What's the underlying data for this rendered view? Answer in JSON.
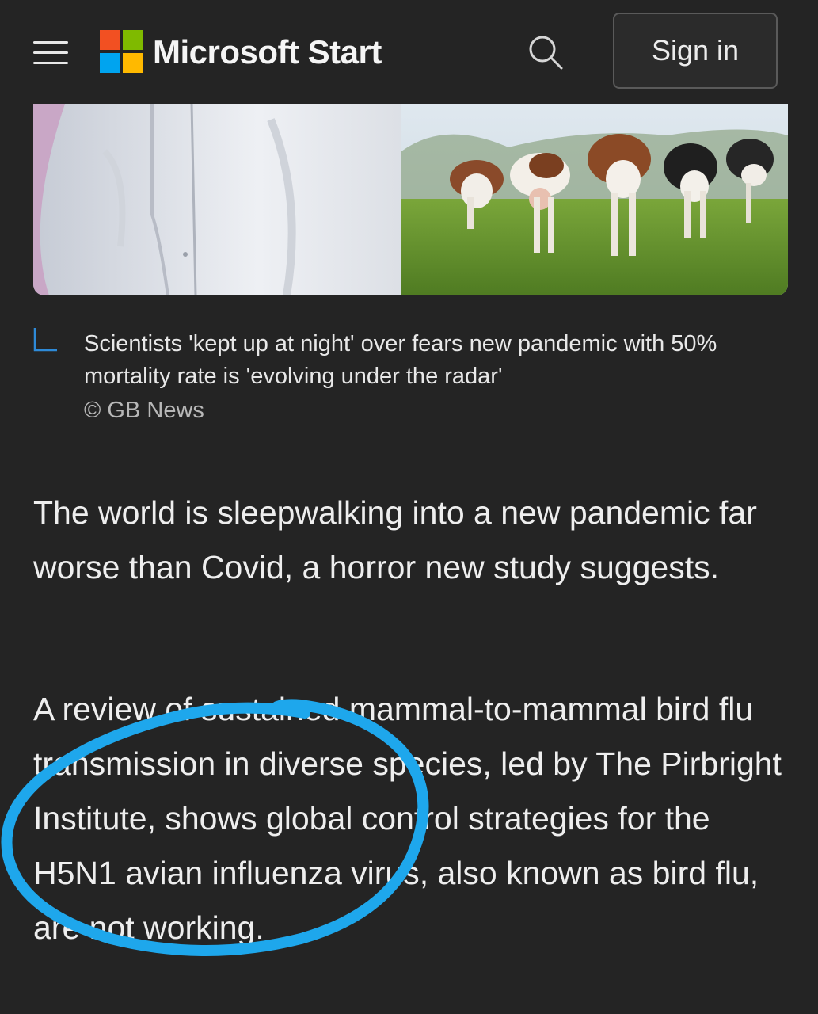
{
  "header": {
    "menu_icon": "hamburger-menu-icon",
    "logo_icon": "microsoft-logo-icon",
    "brand": "Microsoft Start",
    "search_icon": "search-icon",
    "sign_in": "Sign in"
  },
  "hero": {
    "image_description_icon": "article-hero-image"
  },
  "caption": {
    "text": "Scientists 'kept up at night' over fears new pandemic with 50% mortality rate is 'evolving under the radar'",
    "credit": "© GB News"
  },
  "article": {
    "paragraphs": [
      "The world is sleepwalking into a new pandemic far worse than Covid, a horror new study suggests.",
      "A review of sustained mammal-to-mammal bird flu transmission in diverse species, led by The Pirbright Institute, shows global control strategies for the H5N1 avian influenza virus, also known as bird flu, are not working."
    ]
  },
  "colors": {
    "background": "#242424",
    "annotation": "#1ea7ec",
    "logo_red": "#f25022",
    "logo_green": "#7fba00",
    "logo_blue": "#00a4ef",
    "logo_yellow": "#ffb900"
  }
}
